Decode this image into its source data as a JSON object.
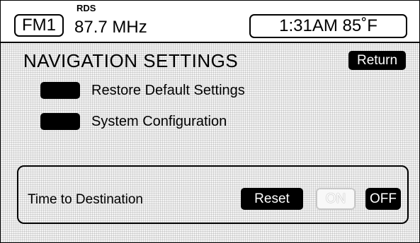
{
  "status_bar": {
    "band": "FM1",
    "rds_label": "RDS",
    "frequency": "87.7 MHz",
    "clock_temp": "1:31AM 85˚F"
  },
  "page": {
    "title": "NAVIGATION SETTINGS",
    "return_label": "Return"
  },
  "options": [
    {
      "label": "Restore Default Settings"
    },
    {
      "label": "System Configuration"
    }
  ],
  "time_to_destination": {
    "label": "Time to Destination",
    "reset_label": "Reset",
    "on_label": "ON",
    "off_label": "OFF",
    "state": "OFF"
  },
  "colors": {
    "button_fill": "#000000",
    "disabled_border": "#c8c8c8"
  }
}
